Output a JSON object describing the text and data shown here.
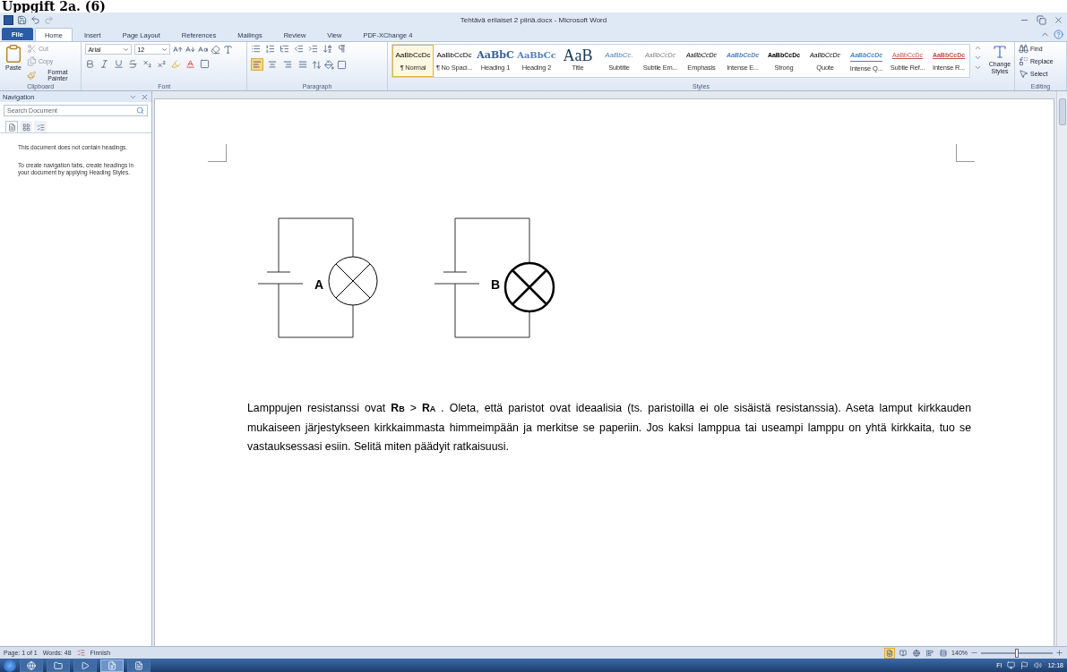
{
  "heading": "Uppgift 2a. (6)",
  "window": {
    "title": "Tehtävä erilaiset 2 piiriä.docx - Microsoft Word"
  },
  "ribbon_tabs": [
    {
      "label": "File",
      "kind": "file",
      "selected": false
    },
    {
      "label": "Home",
      "kind": "tab",
      "selected": true
    },
    {
      "label": "Insert",
      "kind": "tab",
      "selected": false
    },
    {
      "label": "Page Layout",
      "kind": "tab",
      "selected": false
    },
    {
      "label": "References",
      "kind": "tab",
      "selected": false
    },
    {
      "label": "Mailings",
      "kind": "tab",
      "selected": false
    },
    {
      "label": "Review",
      "kind": "tab",
      "selected": false
    },
    {
      "label": "View",
      "kind": "tab",
      "selected": false
    },
    {
      "label": "PDF-XChange 4",
      "kind": "tab",
      "selected": false
    }
  ],
  "clipboard": {
    "paste": "Paste",
    "cut": "Cut",
    "copy": "Copy",
    "format_painter": "Format Painter",
    "label": "Clipboard"
  },
  "font": {
    "name": "Arial",
    "size": "12",
    "label": "Font"
  },
  "paragraph": {
    "alignment_buttons": [
      {
        "kind": "left",
        "selected": true
      },
      {
        "kind": "center",
        "selected": false
      },
      {
        "kind": "right",
        "selected": false
      },
      {
        "kind": "justify",
        "selected": false
      }
    ],
    "label": "Paragraph"
  },
  "styles": {
    "label": "Styles",
    "change": "Change Styles",
    "items": [
      {
        "preview": "AaBbCcDc",
        "name": "¶ Normal",
        "kind": "normal",
        "selected": true
      },
      {
        "preview": "AaBbCcDc",
        "name": "¶ No Spaci...",
        "kind": "normal",
        "selected": false
      },
      {
        "preview": "AaBbC",
        "name": "Heading 1",
        "kind": "heading1",
        "selected": false
      },
      {
        "preview": "AaBbCc",
        "name": "Heading 2",
        "kind": "heading2",
        "selected": false
      },
      {
        "preview": "AaB",
        "name": "Title",
        "kind": "title",
        "selected": false
      },
      {
        "preview": "AaBbCc.",
        "name": "Subtitle",
        "kind": "subtitle",
        "selected": false
      },
      {
        "preview": "AaBbCcDc",
        "name": "Subtle Em...",
        "kind": "subtle",
        "selected": false
      },
      {
        "preview": "AaBbCcDc",
        "name": "Emphasis",
        "kind": "emphasis",
        "selected": false
      },
      {
        "preview": "AaBbCcDc",
        "name": "Intense E...",
        "kind": "intense",
        "selected": false
      },
      {
        "preview": "AaBbCcDc",
        "name": "Strong",
        "kind": "strong",
        "selected": false
      },
      {
        "preview": "AaBbCcDc",
        "name": "Quote",
        "kind": "quote",
        "selected": false
      },
      {
        "preview": "AaBbCcDc",
        "name": "Intense Q...",
        "kind": "intense_quote",
        "selected": false
      },
      {
        "preview": "AaBbCcDc",
        "name": "Subtle Ref...",
        "kind": "subtle_ref",
        "selected": false
      },
      {
        "preview": "AaBbCcDc",
        "name": "Intense R...",
        "kind": "intense_ref",
        "selected": false
      }
    ]
  },
  "editing": {
    "find": "Find",
    "replace": "Replace",
    "select": "Select",
    "label": "Editing"
  },
  "navigation": {
    "title": "Navigation",
    "search": {
      "placeholder": "Search Document"
    },
    "tabs": [
      {
        "kind": "headings",
        "selected": true
      },
      {
        "kind": "pages",
        "selected": false
      },
      {
        "kind": "results",
        "selected": false
      }
    ],
    "messages": [
      "This document does not contain headings.",
      "To create navigation tabs, create headings in your document by applying Heading Styles."
    ]
  },
  "document": {
    "circuits": [
      {
        "label": "A",
        "bold_lamp": false
      },
      {
        "label": "B",
        "bold_lamp": true
      }
    ],
    "text": "Lamppujen resistanssi ovat **R**$_{B}$  > **R**$_{A}$ . Oleta, että paristot ovat ideaalisia (ts. paristoilla ei ole sisäistä resistanssia). Aseta lamput kirkkauden mukaiseen järjestykseen kirkkaimmasta himmeimpään ja merkitse se paperiin. Jos kaksi lamppua tai useampi lamppu on yhtä kirkkaita, tuo se vastauksessasi esiin. Selitä miten päädyit ratkaisuusi."
  },
  "status_bar": {
    "page": "Page: 1 of 1",
    "words": "Words: 48",
    "language": "Finnish",
    "views": [
      {
        "kind": "print",
        "selected": true
      },
      {
        "kind": "reading",
        "selected": false
      },
      {
        "kind": "web",
        "selected": false
      },
      {
        "kind": "outline",
        "selected": false
      },
      {
        "kind": "draft",
        "selected": false
      }
    ],
    "zoom": "140%",
    "zoom_level": {
      "level": 0.5
    }
  },
  "taskbar": {
    "apps": [
      {
        "kind": "browser",
        "selected": false
      },
      {
        "kind": "folder",
        "selected": false
      },
      {
        "kind": "media",
        "selected": false
      },
      {
        "kind": "word",
        "selected": true
      },
      {
        "kind": "pdf",
        "selected": false
      }
    ],
    "language": "FI",
    "time": "12:18"
  }
}
